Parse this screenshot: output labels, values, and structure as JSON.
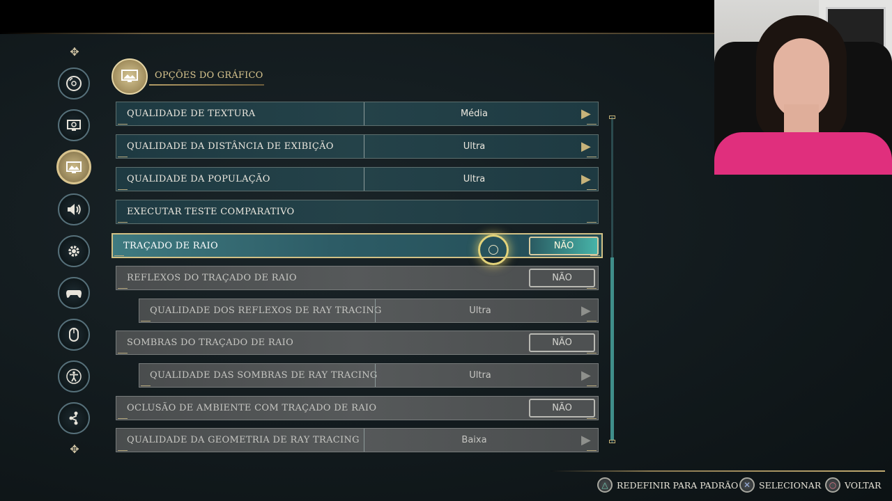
{
  "header": {
    "title": "OPÇÕES DO GRÁFICO",
    "icon": "image-icon"
  },
  "sidebar": {
    "items": [
      {
        "name": "disc-icon",
        "active": false
      },
      {
        "name": "display-settings-icon",
        "active": false
      },
      {
        "name": "graphics-icon",
        "active": true
      },
      {
        "name": "speaker-icon",
        "active": false
      },
      {
        "name": "gear-icon",
        "active": false
      },
      {
        "name": "gamepad-icon",
        "active": false
      },
      {
        "name": "mouse-icon",
        "active": false
      },
      {
        "name": "accessibility-icon",
        "active": false
      },
      {
        "name": "share-icon",
        "active": false
      }
    ]
  },
  "settings": {
    "texture_quality": {
      "label": "QUALIDADE DE TEXTURA",
      "value": "Média"
    },
    "view_distance": {
      "label": "QUALIDADE DA DISTÂNCIA DE EXIBIÇÃO",
      "value": "Ultra"
    },
    "population": {
      "label": "QUALIDADE DA POPULAÇÃO",
      "value": "Ultra"
    },
    "benchmark": {
      "label": "EXECUTAR TESTE COMPARATIVO"
    },
    "ray_tracing": {
      "label": "TRAÇADO DE RAIO",
      "value": "NÃO"
    },
    "rt_reflections": {
      "label": "REFLEXOS DO TRAÇADO DE RAIO",
      "value": "NÃO"
    },
    "rt_reflections_quality": {
      "label": "QUALIDADE DOS REFLEXOS DE RAY TRACING",
      "value": "Ultra"
    },
    "rt_shadows": {
      "label": "SOMBRAS DO TRAÇADO DE RAIO",
      "value": "NÃO"
    },
    "rt_shadows_quality": {
      "label": "QUALIDADE DAS SOMBRAS DE RAY TRACING",
      "value": "Ultra"
    },
    "rt_ao": {
      "label": "OCLUSÃO DE AMBIENTE COM TRAÇADO DE RAIO",
      "value": "NÃO"
    },
    "rt_geometry_quality": {
      "label": "QUALIDADE DA GEOMETRIA DE RAY TRACING",
      "value": "Baixa"
    }
  },
  "footer": {
    "reset": {
      "label": "REDEFINIR PARA PADRÃO",
      "icon": "triangle-button-icon"
    },
    "select": {
      "label": "SELECIONAR",
      "icon": "cross-button-icon"
    },
    "back": {
      "label": "VOLTAR",
      "icon": "circle-button-icon"
    }
  },
  "colors": {
    "accent_gold": "#d8c58e",
    "row_active": "#2d5c66",
    "row_disabled": "#53575a"
  }
}
